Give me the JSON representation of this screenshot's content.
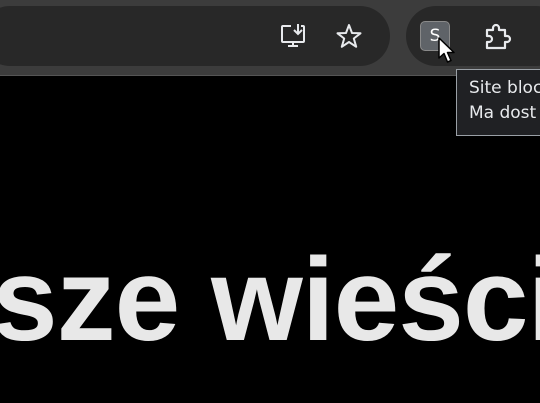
{
  "toolbar": {
    "install_icon": "install-app-icon",
    "bookmark_icon": "bookmark-star-icon",
    "extension_label": "S",
    "extensions_icon": "puzzle-icon"
  },
  "tooltip": {
    "line1": "Site bloc",
    "line2": "Ma dost"
  },
  "page": {
    "headline": "sze wieści"
  },
  "colors": {
    "toolbar_bg": "#3c3c3c",
    "omnibox_bg": "#282828",
    "page_bg": "#000000",
    "headline": "#e8e8e8"
  }
}
